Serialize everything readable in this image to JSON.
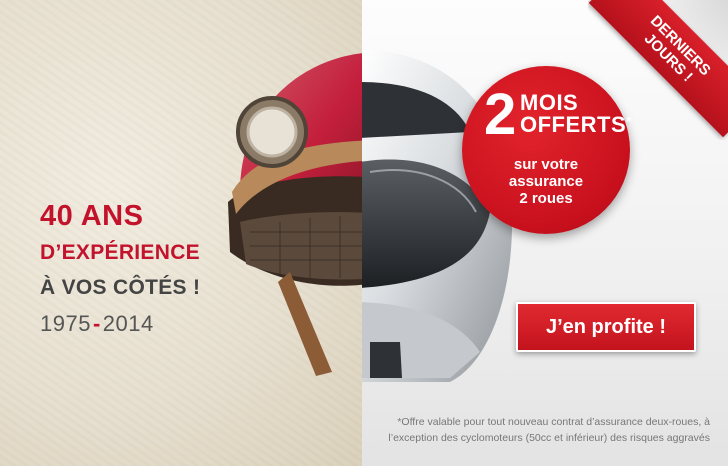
{
  "ribbon": {
    "line1": "DERNIERS",
    "line2": "JOURS !"
  },
  "headline": {
    "line1": "40 ANS",
    "line2": "D’EXPÉRIENCE",
    "line3": "À VOS CÔTÉS !",
    "year_start": "1975",
    "year_sep": "-",
    "year_end": "2014"
  },
  "offer": {
    "number": "2",
    "line1": "MOIS",
    "line2": "OFFERTS",
    "asterisk": "*",
    "sub1": "sur votre",
    "sub2": "assurance",
    "sub3": "2 roues"
  },
  "cta": {
    "label": "J’en profite !"
  },
  "disclaimer": {
    "line1": "*Offre valable pour tout nouveau contrat d’assurance deux-roues, à",
    "line2": "l’exception des cyclomoteurs (50cc et inférieur) des risques aggravés"
  },
  "colors": {
    "brand_red": "#c3132c",
    "text_grey": "#444444"
  }
}
